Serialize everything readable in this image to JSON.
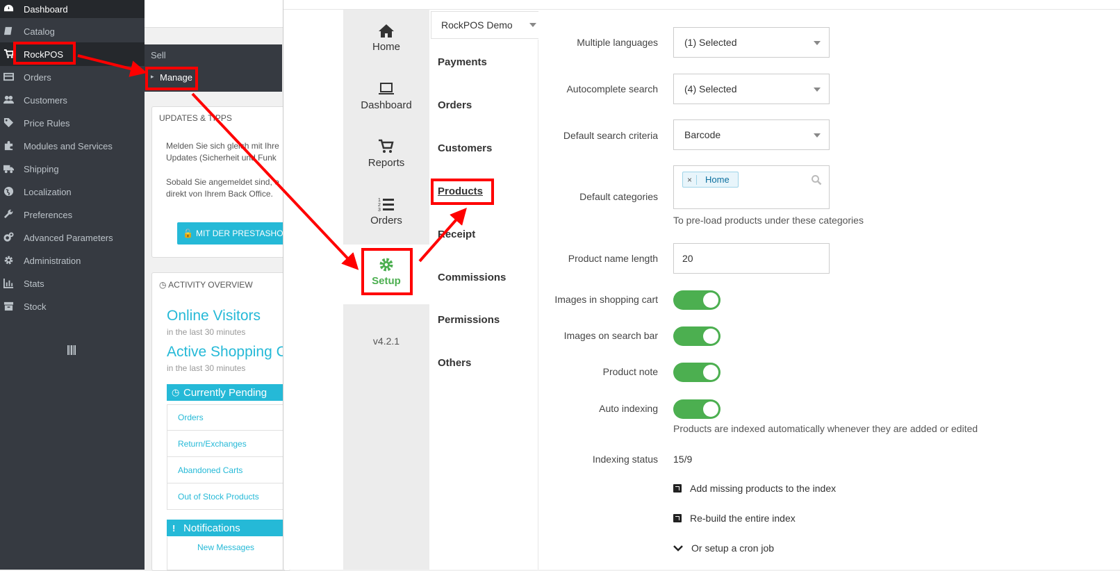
{
  "sidebar": {
    "items": [
      {
        "label": "Dashboard",
        "icon": "dashboard-icon"
      },
      {
        "label": "Catalog",
        "icon": "book-icon"
      },
      {
        "label": "RockPOS",
        "icon": "cart-icon"
      },
      {
        "label": "Orders",
        "icon": "credit-card-icon"
      },
      {
        "label": "Customers",
        "icon": "users-icon"
      },
      {
        "label": "Price Rules",
        "icon": "tags-icon"
      },
      {
        "label": "Modules and Services",
        "icon": "puzzle-icon"
      },
      {
        "label": "Shipping",
        "icon": "truck-icon"
      },
      {
        "label": "Localization",
        "icon": "globe-icon"
      },
      {
        "label": "Preferences",
        "icon": "wrench-icon"
      },
      {
        "label": "Advanced Parameters",
        "icon": "cogs-icon"
      },
      {
        "label": "Administration",
        "icon": "gear-icon"
      },
      {
        "label": "Stats",
        "icon": "bar-chart-icon"
      },
      {
        "label": "Stock",
        "icon": "archive-icon"
      }
    ],
    "submenu": {
      "sell": "Sell",
      "manage": "Manage"
    }
  },
  "dashboard": {
    "updates_title": "UPDATES & TIPPS",
    "updates_text_1": "Melden Sie sich gleich mit Ihre",
    "updates_text_2": "Updates (Sicherheit und Funk",
    "updates_text_3": "Sobald Sie angemeldet sind, e",
    "updates_text_4": "direkt von Ihrem Back Office.",
    "prestashop_button": "MIT DER PRESTASHOP-",
    "activity_title": "ACTIVITY OVERVIEW",
    "online_visitors": "Online Visitors",
    "online_visitors_sub": "in the last 30 minutes",
    "active_carts": "Active Shopping C",
    "active_carts_sub": "in the last 30 minutes",
    "currently_pending": "Currently Pending",
    "pending_items": [
      "Orders",
      "Return/Exchanges",
      "Abandoned Carts",
      "Out of Stock Products"
    ],
    "notifications": "Notifications",
    "new_messages": "New Messages"
  },
  "pos": {
    "rail": [
      {
        "label": "Home",
        "icon": "home-icon"
      },
      {
        "label": "Dashboard",
        "icon": "laptop-icon"
      },
      {
        "label": "Reports",
        "icon": "cart-icon"
      },
      {
        "label": "Orders",
        "icon": "list-ordered-icon"
      },
      {
        "label": "Setup",
        "icon": "gear-icon"
      }
    ],
    "version": "v4.2.1",
    "store_select": "RockPOS Demo",
    "submenu": [
      "Payments",
      "Orders",
      "Customers",
      "Products",
      "Receipt",
      "Commissions",
      "Permissions",
      "Others"
    ],
    "form": {
      "multiple_languages": {
        "label": "Multiple languages",
        "value": "(1) Selected"
      },
      "autocomplete_search": {
        "label": "Autocomplete search",
        "value": "(4) Selected"
      },
      "default_search_criteria": {
        "label": "Default search criteria",
        "value": "Barcode"
      },
      "default_categories": {
        "label": "Default categories",
        "tag": "Home",
        "help": "To pre-load products under these categories"
      },
      "product_name_length": {
        "label": "Product name length",
        "value": "20"
      },
      "images_in_cart": {
        "label": "Images in shopping cart",
        "on": true
      },
      "images_on_search": {
        "label": "Images on search bar",
        "on": true
      },
      "product_note": {
        "label": "Product note",
        "on": true
      },
      "auto_indexing": {
        "label": "Auto indexing",
        "on": true,
        "help": "Products are indexed automatically whenever they are added or edited"
      },
      "indexing_status": {
        "label": "Indexing status",
        "value": "15/9"
      },
      "actions": [
        "Add missing products to the index",
        "Re-build the entire index",
        "Or setup a cron job"
      ]
    }
  },
  "colors": {
    "sidebar": "#363a41",
    "accent": "#25b9d7",
    "toggle": "#4caf50",
    "annotation": "#ff0000"
  }
}
